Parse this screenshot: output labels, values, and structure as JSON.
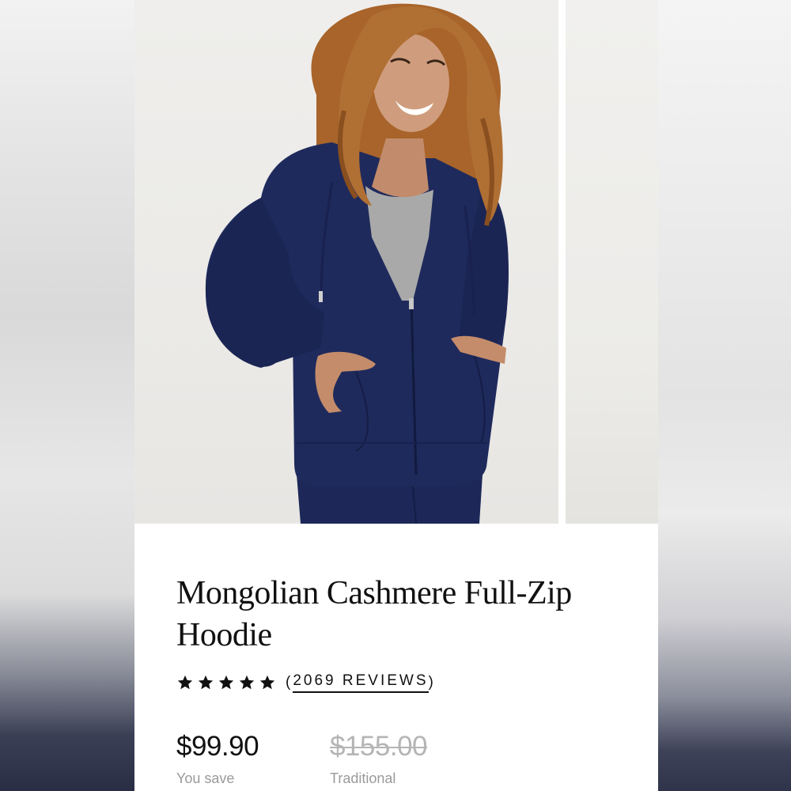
{
  "product": {
    "title": "Mongolian Cashmere Full-Zip Hoodie",
    "rating": {
      "stars": 5,
      "max_stars": 5,
      "reviews_open": "(",
      "reviews_label": "2069 REVIEWS",
      "reviews_close": ")"
    },
    "price": {
      "current": "$99.90",
      "current_label": "You save",
      "traditional": "$155.00",
      "traditional_label": "Traditional"
    }
  },
  "colors": {
    "hoodie": "#1f2a5c",
    "text": "#111111",
    "muted": "#9a9a9a",
    "strike": "#b5b5b5"
  },
  "icons": {
    "star": "star-icon"
  }
}
